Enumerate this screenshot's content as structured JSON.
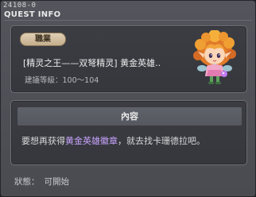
{
  "window": {
    "quest_id": "24108-0",
    "title": "QUEST INFO"
  },
  "header_panel": {
    "job_badge": "職業",
    "quest_name": "[精灵之王——双弩精灵] 黄金英雄..",
    "level_label": "建議等級：",
    "level_range": "100～104",
    "npc_icon": "fairy-npc-avatar-icon"
  },
  "content_panel": {
    "header": "內容",
    "text_before": "要想再获得",
    "highlight": "黄金英雄徽章",
    "text_after": "，就去找卡珊德拉吧。",
    "highlight_color": "#c9a4ff"
  },
  "status": {
    "label": "狀態：",
    "value": "可開始"
  }
}
